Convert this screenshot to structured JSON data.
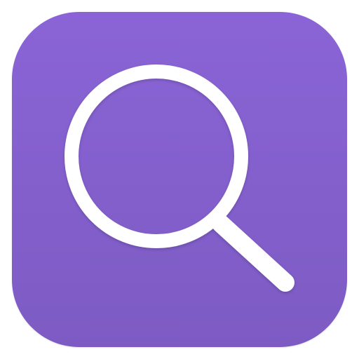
{
  "app_icon": {
    "icon": "search-icon",
    "background_color": "#8564cf",
    "glyph_color": "#ffffff"
  }
}
